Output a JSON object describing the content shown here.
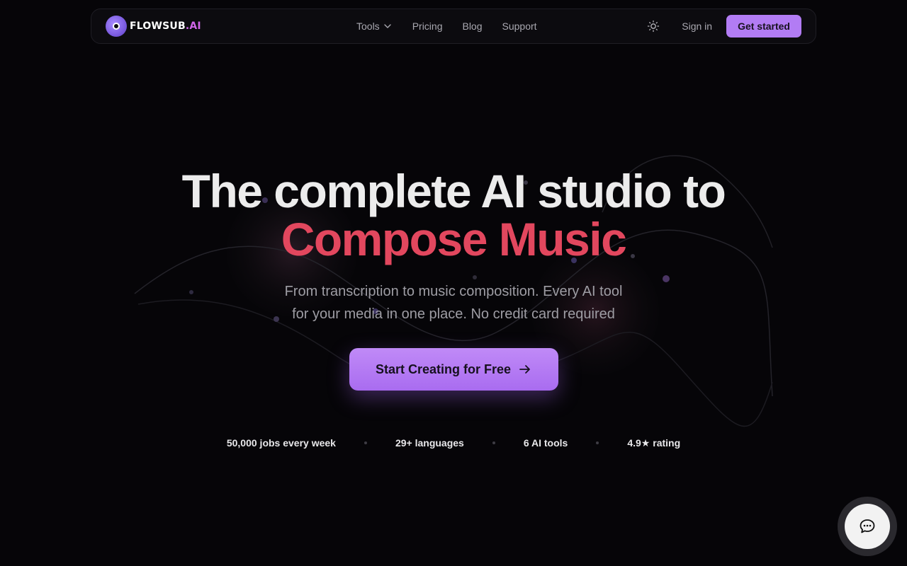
{
  "brand": {
    "name": "FLOWSUB",
    "suffix": ".AI",
    "accent_color": "#b27cf4",
    "logo_icon": "flowsub-logo-icon"
  },
  "nav": {
    "links": [
      {
        "label": "Tools",
        "has_dropdown": true,
        "icon": "chevron-down-icon"
      },
      {
        "label": "Pricing"
      },
      {
        "label": "Blog"
      },
      {
        "label": "Support"
      }
    ],
    "theme_toggle_icon": "sun-icon",
    "signin_label": "Sign in",
    "cta_label": "Get started"
  },
  "hero": {
    "title_line1": "The complete AI studio to",
    "title_line2": "Compose Music",
    "title_accent_color": "#e2475e",
    "subtitle_line1": "From transcription to music composition. Every AI tool",
    "subtitle_line2": "for your media in one place. No credit card required",
    "cta_label": "Start Creating for Free",
    "cta_icon": "arrow-right-icon"
  },
  "stats": [
    "50,000 jobs every week",
    "29+ languages",
    "6 AI tools",
    "4.9★ rating"
  ],
  "chat_widget": {
    "icon": "chat-bubble-icon"
  }
}
